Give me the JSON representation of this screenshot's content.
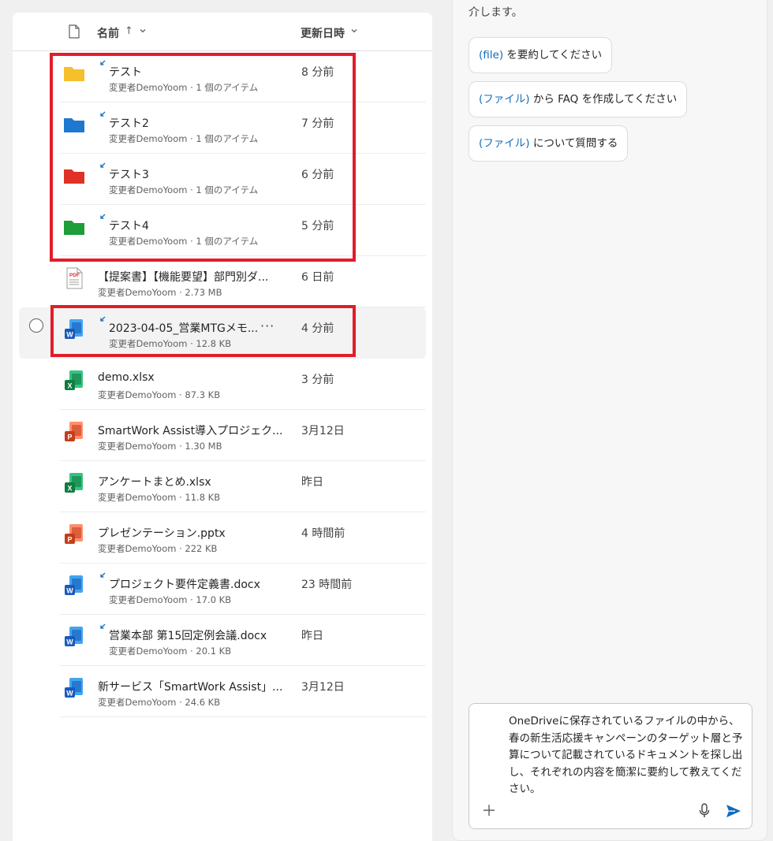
{
  "file_list": {
    "columns": {
      "name": "名前",
      "sort_arrow": "↑",
      "modified": "更新日時"
    },
    "rows": [
      {
        "type": "folder",
        "folder_color": "#f5c02b",
        "shared": true,
        "name": "テスト",
        "meta": "変更者DemoYoom · 1 個のアイテム",
        "date": "8 分前"
      },
      {
        "type": "folder",
        "folder_color": "#1e78d0",
        "shared": true,
        "name": "テスト2",
        "meta": "変更者DemoYoom · 1 個のアイテム",
        "date": "7 分前"
      },
      {
        "type": "folder",
        "folder_color": "#df3127",
        "shared": true,
        "name": "テスト3",
        "meta": "変更者DemoYoom · 1 個のアイテム",
        "date": "6 分前"
      },
      {
        "type": "folder",
        "folder_color": "#1f9d3a",
        "shared": true,
        "name": "テスト4",
        "meta": "変更者DemoYoom · 1 個のアイテム",
        "date": "5 分前"
      },
      {
        "type": "pdf",
        "shared": false,
        "name": "【提案書】【機能要望】部門別ダ...",
        "meta": "変更者DemoYoom · 2.73 MB",
        "date": "6 日前",
        "icon_label": "PDF"
      },
      {
        "type": "word",
        "shared": true,
        "selected": true,
        "name": "2023-04-05_営業MTGメモ...",
        "more": "···",
        "meta": "変更者DemoYoom · 12.8 KB",
        "date": "4 分前",
        "icon_label": "W"
      },
      {
        "type": "excel",
        "shared": false,
        "name": "demo.xlsx",
        "meta": "変更者DemoYoom · 87.3 KB",
        "date": "3 分前",
        "icon_label": "X"
      },
      {
        "type": "ppt",
        "shared": false,
        "name": "SmartWork Assist導入プロジェク...",
        "meta": "変更者DemoYoom · 1.30 MB",
        "date": "3月12日",
        "icon_label": "P"
      },
      {
        "type": "excel",
        "shared": false,
        "name": "アンケートまとめ.xlsx",
        "meta": "変更者DemoYoom · 11.8 KB",
        "date": "昨日",
        "icon_label": "X"
      },
      {
        "type": "ppt",
        "shared": false,
        "name": "プレゼンテーション.pptx",
        "meta": "変更者DemoYoom · 222 KB",
        "date": "4 時間前",
        "icon_label": "P"
      },
      {
        "type": "word",
        "shared": true,
        "name": "プロジェクト要件定義書.docx",
        "meta": "変更者DemoYoom · 17.0 KB",
        "date": "23 時間前",
        "icon_label": "W"
      },
      {
        "type": "word",
        "shared": true,
        "name": "営業本部 第15回定例会議.docx",
        "meta": "変更者DemoYoom · 20.1 KB",
        "date": "昨日",
        "icon_label": "W"
      },
      {
        "type": "word",
        "shared": false,
        "name": "新サービス「SmartWork Assist」...",
        "meta": "変更者DemoYoom · 24.6 KB",
        "date": "3月12日",
        "icon_label": "W"
      }
    ]
  },
  "chat": {
    "intro_tail": "介します。",
    "suggestions": [
      {
        "tag": "(file)",
        "text": " を要約してください"
      },
      {
        "tag": "(ファイル)",
        "text": " から FAQ を作成してください"
      },
      {
        "tag": "(ファイル)",
        "text": " について質問する"
      }
    ],
    "composer_text": "OneDriveに保存されているファイルの中から、春の新生活応援キャンペーンのターゲット層と予算について記載されているドキュメントを探し出し、それぞれの内容を簡潔に要約して教えてください。"
  },
  "colors": {
    "highlight": "#e11d2a",
    "accent": "#0f6cbd",
    "word": "#185abd",
    "excel": "#107c41",
    "ppt": "#c43e1c",
    "pdf": "#d13438"
  }
}
